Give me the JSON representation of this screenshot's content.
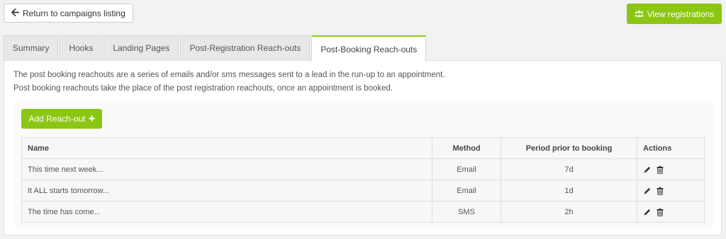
{
  "header": {
    "back_label": "Return to campaigns listing",
    "view_registrations_label": "View registrations"
  },
  "tabs": [
    {
      "label": "Summary"
    },
    {
      "label": "Hooks"
    },
    {
      "label": "Landing Pages"
    },
    {
      "label": "Post-Registration Reach-outs"
    },
    {
      "label": "Post-Booking Reach-outs",
      "active": true
    }
  ],
  "description": {
    "line1": "The post booking reachouts are a series of emails and/or sms messages sent to a lead in the run-up to an appointment.",
    "line2": "Post booking reachouts take the place of the post registration reachouts, once an appointment is booked."
  },
  "add_button_label": "Add Reach-out",
  "table": {
    "headers": {
      "name": "Name",
      "method": "Method",
      "period": "Period prior to booking",
      "actions": "Actions"
    },
    "rows": [
      {
        "name": "This time next week...",
        "method": "Email",
        "period": "7d"
      },
      {
        "name": "It ALL starts tomorrow...",
        "method": "Email",
        "period": "1d"
      },
      {
        "name": "The time has come...",
        "method": "SMS",
        "period": "2h"
      }
    ]
  },
  "colors": {
    "accent": "#8cc614",
    "panel_bg": "#ffffff",
    "page_bg": "#f2f2f2"
  },
  "icons": {
    "back": "arrow-left-icon",
    "view": "users-icon",
    "add": "plus-icon",
    "edit": "pencil-icon",
    "delete": "trash-icon"
  }
}
